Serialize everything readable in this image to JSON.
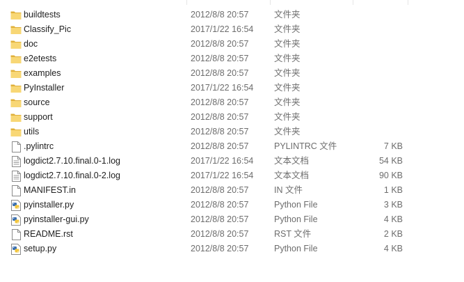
{
  "colors": {
    "folder": "#f8d775",
    "folder_dark": "#e0b03a",
    "text_primary": "#1e1e1e",
    "text_secondary": "#6d6d6d",
    "python_blue": "#3a6fb0",
    "python_yellow": "#f2c53d"
  },
  "files": [
    {
      "name": "buildtests",
      "date": "2012/8/8 20:57",
      "type": "文件夹",
      "size": "",
      "icon": "folder-icon"
    },
    {
      "name": "Classify_Pic",
      "date": "2017/1/22 16:54",
      "type": "文件夹",
      "size": "",
      "icon": "folder-icon"
    },
    {
      "name": "doc",
      "date": "2012/8/8 20:57",
      "type": "文件夹",
      "size": "",
      "icon": "folder-icon"
    },
    {
      "name": "e2etests",
      "date": "2012/8/8 20:57",
      "type": "文件夹",
      "size": "",
      "icon": "folder-icon"
    },
    {
      "name": "examples",
      "date": "2012/8/8 20:57",
      "type": "文件夹",
      "size": "",
      "icon": "folder-icon"
    },
    {
      "name": "PyInstaller",
      "date": "2017/1/22 16:54",
      "type": "文件夹",
      "size": "",
      "icon": "folder-icon"
    },
    {
      "name": "source",
      "date": "2012/8/8 20:57",
      "type": "文件夹",
      "size": "",
      "icon": "folder-icon"
    },
    {
      "name": "support",
      "date": "2012/8/8 20:57",
      "type": "文件夹",
      "size": "",
      "icon": "folder-icon"
    },
    {
      "name": "utils",
      "date": "2012/8/8 20:57",
      "type": "文件夹",
      "size": "",
      "icon": "folder-icon"
    },
    {
      "name": ".pylintrc",
      "date": "2012/8/8 20:57",
      "type": "PYLINTRC 文件",
      "size": "7 KB",
      "icon": "file-icon"
    },
    {
      "name": "logdict2.7.10.final.0-1.log",
      "date": "2017/1/22 16:54",
      "type": "文本文档",
      "size": "54 KB",
      "icon": "text-file-icon"
    },
    {
      "name": "logdict2.7.10.final.0-2.log",
      "date": "2017/1/22 16:54",
      "type": "文本文档",
      "size": "90 KB",
      "icon": "text-file-icon"
    },
    {
      "name": "MANIFEST.in",
      "date": "2012/8/8 20:57",
      "type": "IN 文件",
      "size": "1 KB",
      "icon": "file-icon"
    },
    {
      "name": "pyinstaller.py",
      "date": "2012/8/8 20:57",
      "type": "Python File",
      "size": "3 KB",
      "icon": "python-file-icon"
    },
    {
      "name": "pyinstaller-gui.py",
      "date": "2012/8/8 20:57",
      "type": "Python File",
      "size": "4 KB",
      "icon": "python-file-icon"
    },
    {
      "name": "README.rst",
      "date": "2012/8/8 20:57",
      "type": "RST 文件",
      "size": "2 KB",
      "icon": "file-icon"
    },
    {
      "name": "setup.py",
      "date": "2012/8/8 20:57",
      "type": "Python File",
      "size": "4 KB",
      "icon": "python-file-icon"
    }
  ]
}
